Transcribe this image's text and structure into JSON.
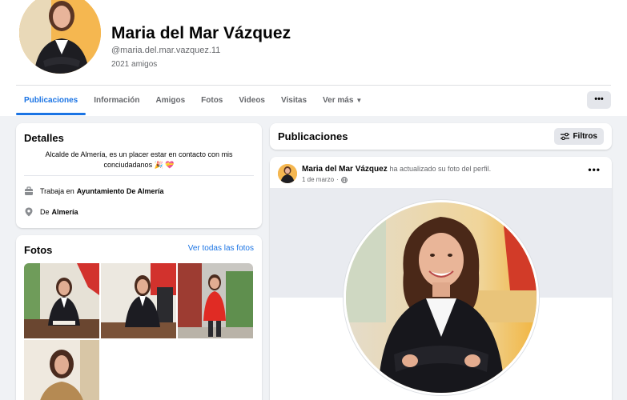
{
  "profile": {
    "name": "Maria del Mar Vázquez",
    "handle": "@maria.del.mar.vazquez.11",
    "friends": "2021 amigos"
  },
  "tabs": [
    {
      "label": "Publicaciones",
      "active": true
    },
    {
      "label": "Información"
    },
    {
      "label": "Amigos"
    },
    {
      "label": "Fotos"
    },
    {
      "label": "Videos"
    },
    {
      "label": "Visitas"
    },
    {
      "label": "Ver más"
    }
  ],
  "more_button": "•••",
  "details": {
    "title": "Detalles",
    "bio": "Alcalde de Almería, es un placer estar en contacto con mis conciudadanos 🎉 💝",
    "work_prefix": "Trabaja en",
    "work_place": "Ayuntamiento De Almería",
    "from_prefix": "De",
    "from_place": "Almería"
  },
  "photos": {
    "title": "Fotos",
    "see_all": "Ver todas las fotos"
  },
  "publications": {
    "title": "Publicaciones",
    "filters_label": "Filtros"
  },
  "post": {
    "author": "Maria del Mar Vázquez",
    "action": "ha actualizado su foto del perfil.",
    "date": "1 de marzo",
    "dots": "•••"
  },
  "colors": {
    "accent": "#1b74e4",
    "background": "#f0f2f5",
    "secondary_text": "#65676b",
    "profile_ring": "#f3b24a"
  },
  "icons": {
    "work": "briefcase-icon",
    "location": "location-pin-icon",
    "filters": "sliders-icon",
    "privacy": "globe-icon",
    "dropdown": "caret-down-icon"
  }
}
